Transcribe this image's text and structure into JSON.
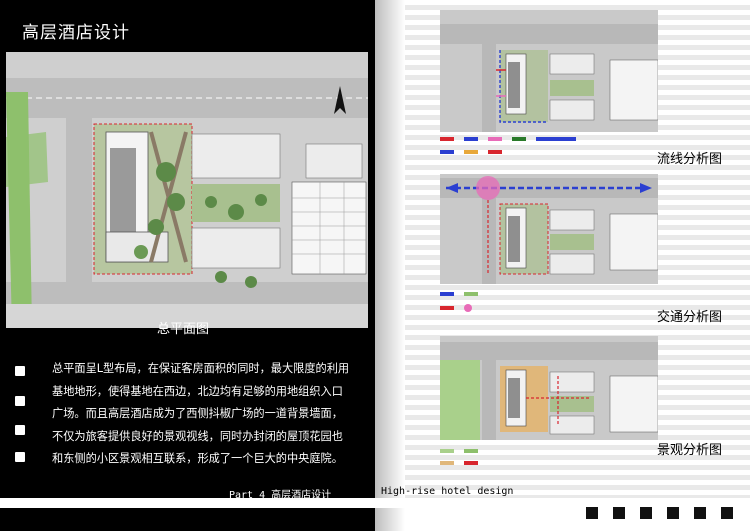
{
  "page": {
    "title": "高层酒店设计",
    "site_plan_caption": "总平面图",
    "description_lines": [
      "总平面呈L型布局，在保证客房面积的同时，最大限度的利用",
      "基地地形，使得基地在西边，北边均有足够的用地组织入口",
      "广场。而且高层酒店成为了西侧抖椒广场的一道背景墙面，",
      "不仅为旅客提供良好的景观视线，同时办封闭的屋顶花园也",
      "和东侧的小区景观相互联系，形成了一个巨大的中央庭院。"
    ],
    "footer_left": "Part 4 高层酒店设计",
    "footer_right": "High-rise hotel design"
  },
  "diagrams": {
    "circulation": {
      "label": "流线分析图"
    },
    "traffic": {
      "label": "交通分析图"
    },
    "landscape": {
      "label": "景观分析图"
    }
  },
  "colors": {
    "background_dark": "#000000",
    "text_light": "#ffffff",
    "plan_road": "#b9b9b9",
    "plan_green": "#6f9a5a",
    "flow_blue": "#2b3fd1",
    "flow_pink": "#e86bb8",
    "boundary_red": "#d8262e"
  }
}
